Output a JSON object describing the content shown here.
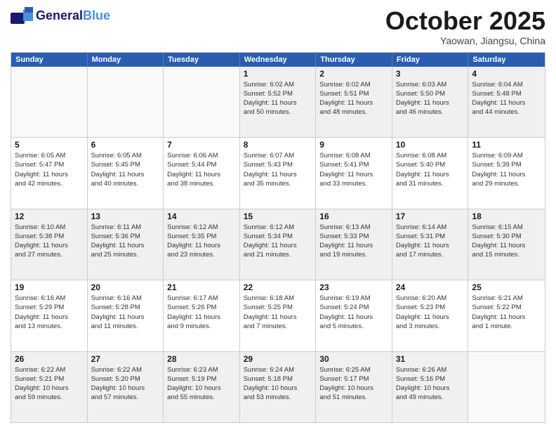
{
  "logo": {
    "text1": "General",
    "text2": "Blue",
    "tagline": ""
  },
  "title": "October 2025",
  "location": "Yaowan, Jiangsu, China",
  "header": {
    "days": [
      "Sunday",
      "Monday",
      "Tuesday",
      "Wednesday",
      "Thursday",
      "Friday",
      "Saturday"
    ]
  },
  "weeks": [
    [
      {
        "day": "",
        "info": ""
      },
      {
        "day": "",
        "info": ""
      },
      {
        "day": "",
        "info": ""
      },
      {
        "day": "1",
        "info": "Sunrise: 6:02 AM\nSunset: 5:52 PM\nDaylight: 11 hours\nand 50 minutes."
      },
      {
        "day": "2",
        "info": "Sunrise: 6:02 AM\nSunset: 5:51 PM\nDaylight: 11 hours\nand 48 minutes."
      },
      {
        "day": "3",
        "info": "Sunrise: 6:03 AM\nSunset: 5:50 PM\nDaylight: 11 hours\nand 46 minutes."
      },
      {
        "day": "4",
        "info": "Sunrise: 6:04 AM\nSunset: 5:48 PM\nDaylight: 11 hours\nand 44 minutes."
      }
    ],
    [
      {
        "day": "5",
        "info": "Sunrise: 6:05 AM\nSunset: 5:47 PM\nDaylight: 11 hours\nand 42 minutes."
      },
      {
        "day": "6",
        "info": "Sunrise: 6:05 AM\nSunset: 5:45 PM\nDaylight: 11 hours\nand 40 minutes."
      },
      {
        "day": "7",
        "info": "Sunrise: 6:06 AM\nSunset: 5:44 PM\nDaylight: 11 hours\nand 38 minutes."
      },
      {
        "day": "8",
        "info": "Sunrise: 6:07 AM\nSunset: 5:43 PM\nDaylight: 11 hours\nand 35 minutes."
      },
      {
        "day": "9",
        "info": "Sunrise: 6:08 AM\nSunset: 5:41 PM\nDaylight: 11 hours\nand 33 minutes."
      },
      {
        "day": "10",
        "info": "Sunrise: 6:08 AM\nSunset: 5:40 PM\nDaylight: 11 hours\nand 31 minutes."
      },
      {
        "day": "11",
        "info": "Sunrise: 6:09 AM\nSunset: 5:39 PM\nDaylight: 11 hours\nand 29 minutes."
      }
    ],
    [
      {
        "day": "12",
        "info": "Sunrise: 6:10 AM\nSunset: 5:38 PM\nDaylight: 11 hours\nand 27 minutes."
      },
      {
        "day": "13",
        "info": "Sunrise: 6:11 AM\nSunset: 5:36 PM\nDaylight: 11 hours\nand 25 minutes."
      },
      {
        "day": "14",
        "info": "Sunrise: 6:12 AM\nSunset: 5:35 PM\nDaylight: 11 hours\nand 23 minutes."
      },
      {
        "day": "15",
        "info": "Sunrise: 6:12 AM\nSunset: 5:34 PM\nDaylight: 11 hours\nand 21 minutes."
      },
      {
        "day": "16",
        "info": "Sunrise: 6:13 AM\nSunset: 5:33 PM\nDaylight: 11 hours\nand 19 minutes."
      },
      {
        "day": "17",
        "info": "Sunrise: 6:14 AM\nSunset: 5:31 PM\nDaylight: 11 hours\nand 17 minutes."
      },
      {
        "day": "18",
        "info": "Sunrise: 6:15 AM\nSunset: 5:30 PM\nDaylight: 11 hours\nand 15 minutes."
      }
    ],
    [
      {
        "day": "19",
        "info": "Sunrise: 6:16 AM\nSunset: 5:29 PM\nDaylight: 11 hours\nand 13 minutes."
      },
      {
        "day": "20",
        "info": "Sunrise: 6:16 AM\nSunset: 5:28 PM\nDaylight: 11 hours\nand 11 minutes."
      },
      {
        "day": "21",
        "info": "Sunrise: 6:17 AM\nSunset: 5:26 PM\nDaylight: 11 hours\nand 9 minutes."
      },
      {
        "day": "22",
        "info": "Sunrise: 6:18 AM\nSunset: 5:25 PM\nDaylight: 11 hours\nand 7 minutes."
      },
      {
        "day": "23",
        "info": "Sunrise: 6:19 AM\nSunset: 5:24 PM\nDaylight: 11 hours\nand 5 minutes."
      },
      {
        "day": "24",
        "info": "Sunrise: 6:20 AM\nSunset: 5:23 PM\nDaylight: 11 hours\nand 3 minutes."
      },
      {
        "day": "25",
        "info": "Sunrise: 6:21 AM\nSunset: 5:22 PM\nDaylight: 11 hours\nand 1 minute."
      }
    ],
    [
      {
        "day": "26",
        "info": "Sunrise: 6:22 AM\nSunset: 5:21 PM\nDaylight: 10 hours\nand 59 minutes."
      },
      {
        "day": "27",
        "info": "Sunrise: 6:22 AM\nSunset: 5:20 PM\nDaylight: 10 hours\nand 57 minutes."
      },
      {
        "day": "28",
        "info": "Sunrise: 6:23 AM\nSunset: 5:19 PM\nDaylight: 10 hours\nand 55 minutes."
      },
      {
        "day": "29",
        "info": "Sunrise: 6:24 AM\nSunset: 5:18 PM\nDaylight: 10 hours\nand 53 minutes."
      },
      {
        "day": "30",
        "info": "Sunrise: 6:25 AM\nSunset: 5:17 PM\nDaylight: 10 hours\nand 51 minutes."
      },
      {
        "day": "31",
        "info": "Sunrise: 6:26 AM\nSunset: 5:16 PM\nDaylight: 10 hours\nand 49 minutes."
      },
      {
        "day": "",
        "info": ""
      }
    ]
  ],
  "shaded_rows": [
    0,
    2,
    4
  ],
  "accent_color": "#2a5db0"
}
